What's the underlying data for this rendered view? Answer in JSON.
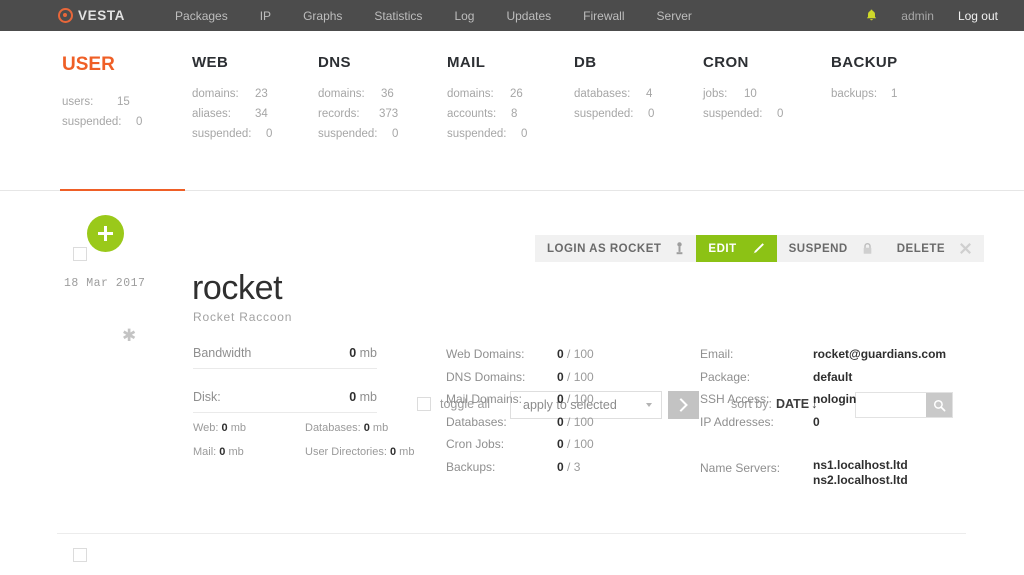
{
  "nav": {
    "logo_text": "VESTA",
    "items": [
      {
        "label": "Packages"
      },
      {
        "label": "IP"
      },
      {
        "label": "Graphs"
      },
      {
        "label": "Statistics"
      },
      {
        "label": "Log"
      },
      {
        "label": "Updates"
      },
      {
        "label": "Firewall"
      },
      {
        "label": "Server"
      }
    ],
    "bell_icon": "bell-icon",
    "user": "admin",
    "logout": "Log out",
    "bar_color": "#4c4c4c",
    "accent_color": "#ef5f26"
  },
  "stats": [
    {
      "title": "USER",
      "active": true,
      "rows": [
        {
          "key": "users:",
          "value": "15"
        },
        {
          "key": "suspended:",
          "value": "0"
        }
      ]
    },
    {
      "title": "WEB",
      "active": false,
      "rows": [
        {
          "key": "domains:",
          "value": "23"
        },
        {
          "key": "aliases:",
          "value": "34"
        },
        {
          "key": "suspended:",
          "value": "0"
        }
      ]
    },
    {
      "title": "DNS",
      "active": false,
      "rows": [
        {
          "key": "domains:",
          "value": "36"
        },
        {
          "key": "records:",
          "value": "373"
        },
        {
          "key": "suspended:",
          "value": "0"
        }
      ]
    },
    {
      "title": "MAIL",
      "active": false,
      "rows": [
        {
          "key": "domains:",
          "value": "26"
        },
        {
          "key": "accounts:",
          "value": "8"
        },
        {
          "key": "suspended:",
          "value": "0"
        }
      ]
    },
    {
      "title": "DB",
      "active": false,
      "rows": [
        {
          "key": "databases:",
          "value": "4"
        },
        {
          "key": "suspended:",
          "value": "0"
        }
      ]
    },
    {
      "title": "CRON",
      "active": false,
      "rows": [
        {
          "key": "jobs:",
          "value": "10"
        },
        {
          "key": "suspended:",
          "value": "0"
        }
      ]
    },
    {
      "title": "BACKUP",
      "active": false,
      "rows": [
        {
          "key": "backups:",
          "value": "1"
        }
      ]
    }
  ],
  "toolbar": {
    "toggle_all_label": "toggle all",
    "apply_select_value": "apply to selected",
    "go_icon": "chevron-right-icon",
    "sort_label": "sort by:",
    "sort_value": "DATE",
    "sort_arrow": "↓",
    "search_value": "",
    "search_placeholder": "",
    "search_icon": "search-icon"
  },
  "actions": [
    {
      "label": "LOGIN AS ROCKET",
      "icon": "login-key-icon",
      "state": "normal"
    },
    {
      "label": "EDIT",
      "icon": "pencil-icon",
      "state": "active"
    },
    {
      "label": "SUSPEND",
      "icon": "lock-icon",
      "state": "normal"
    },
    {
      "label": "DELETE",
      "icon": "close-x-icon",
      "state": "normal"
    }
  ],
  "user_row": {
    "add_button_icon": "plus-icon",
    "date": "18 Mar 2017",
    "star_icon": "star-icon",
    "username": "rocket",
    "fullname": "Rocket Raccoon",
    "bandwidth": {
      "label": "Bandwidth",
      "value": "0",
      "unit": "mb"
    },
    "disk": {
      "label": "Disk:",
      "value": "0",
      "unit": "mb"
    },
    "disk_breakdown": [
      {
        "label": "Web:",
        "value": "0",
        "unit": "mb"
      },
      {
        "label": "Databases:",
        "value": "0",
        "unit": "mb"
      },
      {
        "label": "Mail:",
        "value": "0",
        "unit": "mb"
      },
      {
        "label": "User Directories:",
        "value": "0",
        "unit": "mb"
      }
    ],
    "quotas": [
      {
        "label": "Web Domains:",
        "used": "0",
        "limit": "100"
      },
      {
        "label": "DNS Domains:",
        "used": "0",
        "limit": "100"
      },
      {
        "label": "Mail Domains:",
        "used": "0",
        "limit": "100"
      },
      {
        "label": "Databases:",
        "used": "0",
        "limit": "100"
      },
      {
        "label": "Cron Jobs:",
        "used": "0",
        "limit": "100"
      },
      {
        "label": "Backups:",
        "used": "0",
        "limit": "3"
      }
    ],
    "details": [
      {
        "label": "Email:",
        "value": "rocket@guardians.com"
      },
      {
        "label": "Package:",
        "value": "default"
      },
      {
        "label": "SSH Access:",
        "value": "nologin"
      },
      {
        "label": "IP Addresses:",
        "value": "0"
      }
    ],
    "name_servers": {
      "label": "Name Servers:",
      "values": [
        "ns1.localhost.ltd",
        "ns2.localhost.ltd"
      ]
    }
  }
}
